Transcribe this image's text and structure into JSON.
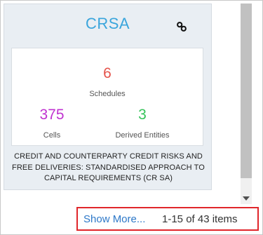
{
  "card": {
    "title": "CRSA",
    "link_icon": "link-icon",
    "stats": {
      "schedules_count": "6",
      "schedules_label": "Schedules",
      "cells_count": "375",
      "cells_label": "Cells",
      "derived_count": "3",
      "derived_label": "Derived Entities"
    },
    "description": "CREDIT AND COUNTERPARTY CREDIT RISKS AND FREE DELIVERIES: STANDARDISED APPROACH TO CAPITAL REQUIREMENTS (CR SA)"
  },
  "pager": {
    "show_more_label": "Show More...",
    "range_label": "1-15 of 43 items"
  },
  "colors": {
    "title": "#3aa5dc",
    "schedules": "#e5534b",
    "cells": "#c032d0",
    "derived": "#36c35a",
    "link": "#2d78c8",
    "highlight": "#e0262b"
  }
}
